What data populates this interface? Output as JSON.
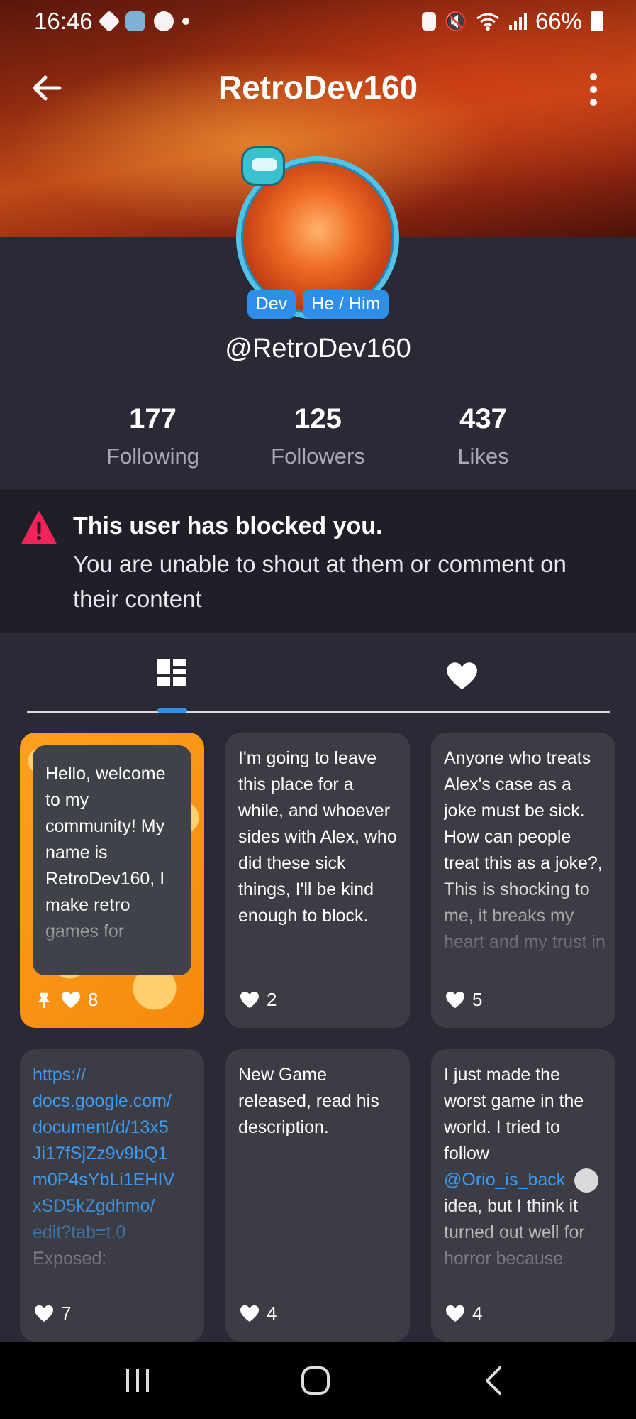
{
  "status_bar": {
    "time": "16:46",
    "battery": "66%"
  },
  "header": {
    "title": "RetroDev160"
  },
  "profile": {
    "badges": [
      "Dev",
      "He / Him"
    ],
    "handle": "@RetroDev160",
    "stats": [
      {
        "value": "177",
        "label": "Following"
      },
      {
        "value": "125",
        "label": "Followers"
      },
      {
        "value": "437",
        "label": "Likes"
      }
    ]
  },
  "notice": {
    "title": "This user has blocked you.",
    "body": "You are unable to shout at them or comment on their content"
  },
  "tabs": {
    "active": "posts",
    "items": [
      "posts-grid-icon",
      "likes-heart-icon"
    ]
  },
  "posts": [
    {
      "text": "Hello, welcome to my community! My name is RetroDev160, I make retro games for",
      "likes": "8",
      "pinned": true
    },
    {
      "text": "I'm going to leave this place for a while, and whoever sides with Alex, who did these sick things, I'll be kind enough to block.",
      "likes": "2"
    },
    {
      "text": "Anyone who treats Alex's case as a joke must be sick. How can people treat this as a joke?, This is shocking to me, it breaks my heart and my trust in",
      "likes": "5"
    },
    {
      "text": "https:// docs.google.com/ document/d/13x5 Ji17fSjZz9v9bQ1 m0P4sYbLi1EHIV xSD5kZgdhmo/ edit?tab=t.0",
      "extra": "Exposed:",
      "likes": "7"
    },
    {
      "text": "New Game released, read his description.",
      "likes": "4"
    },
    {
      "text_before": "I just made the worst game in the world. I tried to follow",
      "mention": "@Orio_is_back",
      "text_after": "idea, but I think it turned out well for horror because",
      "likes": "4"
    }
  ],
  "colors": {
    "accent": "#2f8fe8",
    "warning": "#f0245a",
    "card_bg": "#3b3c44",
    "page_bg": "#2a2a36"
  }
}
